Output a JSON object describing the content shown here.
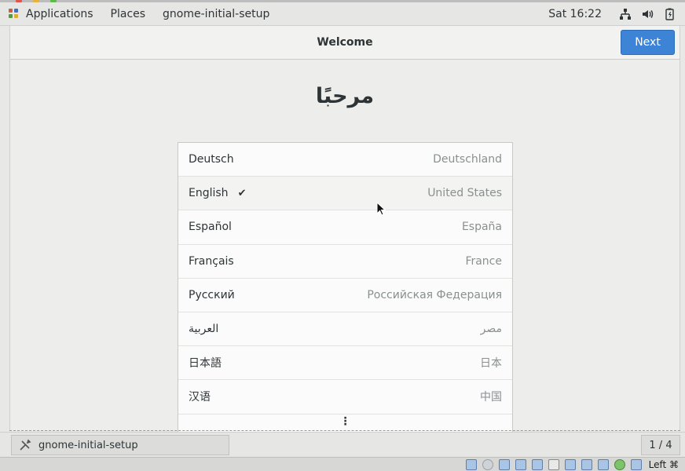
{
  "topbar": {
    "applications_label": "Applications",
    "places_label": "Places",
    "app_name": "gnome-initial-setup",
    "clock": "Sat 16:22"
  },
  "window": {
    "title": "Welcome",
    "next_label": "Next",
    "heading": "مرحبًا"
  },
  "languages": [
    {
      "name": "Deutsch",
      "region": "Deutschland",
      "selected": false
    },
    {
      "name": "English",
      "region": "United States",
      "selected": true
    },
    {
      "name": "Español",
      "region": "España",
      "selected": false
    },
    {
      "name": "Français",
      "region": "France",
      "selected": false
    },
    {
      "name": "Русский",
      "region": "Российская Федерация",
      "selected": false
    },
    {
      "name": "العربية",
      "region": "مصر",
      "selected": false
    },
    {
      "name": "日本語",
      "region": "日本",
      "selected": false
    },
    {
      "name": "汉语",
      "region": "中国",
      "selected": false
    }
  ],
  "check_mark": "✔",
  "more_indicator": "⋮",
  "bottombar": {
    "task_label": "gnome-initial-setup",
    "workspace_pager": "1 / 4"
  },
  "hoststatus": {
    "host_key": "Left ⌘"
  },
  "colors": {
    "accent": "#3d84d7",
    "panel": "#e6e6e4",
    "list_bg": "#fbfbfb"
  }
}
